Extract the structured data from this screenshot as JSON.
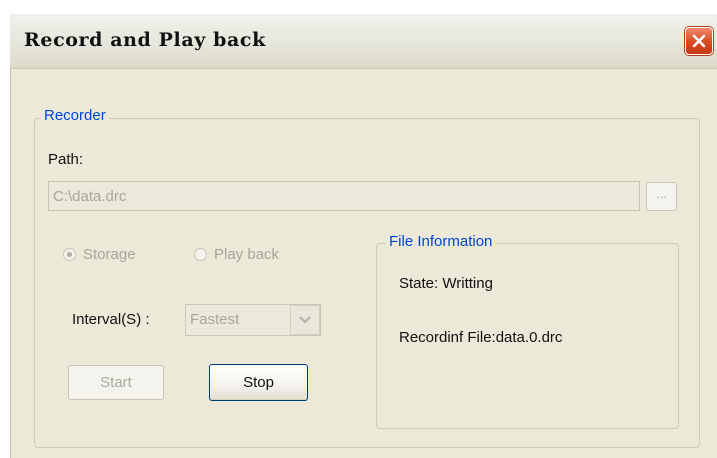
{
  "window": {
    "title": "Record and Play back"
  },
  "recorder": {
    "legend": "Recorder",
    "path_label": "Path:",
    "path_value": "C:\\data.drc",
    "browse_label": "...",
    "radio_storage": "Storage",
    "radio_playback": "Play back",
    "interval_label": "Interval(S) :",
    "interval_value": "Fastest",
    "start_label": "Start",
    "stop_label": "Stop"
  },
  "file_info": {
    "legend": "File Information",
    "state": "State: Writting",
    "recording_file": "Recordinf File:data.0.drc"
  },
  "colors": {
    "legend_blue": "#0046d5",
    "close_red": "#d84a22",
    "dialog_bg": "#ece9d8"
  }
}
